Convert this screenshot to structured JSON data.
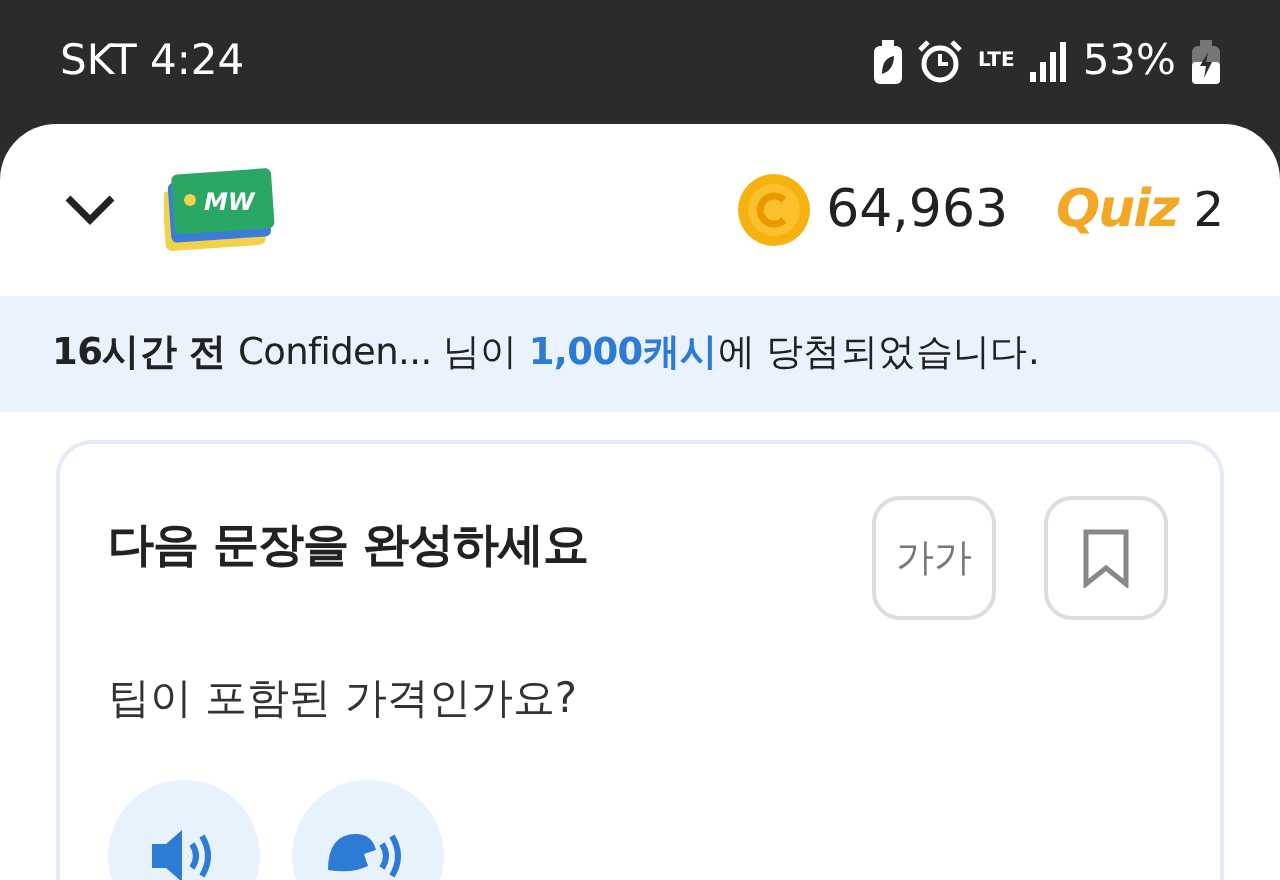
{
  "status_bar": {
    "carrier_time": "SKT 4:24",
    "network": "LTE",
    "battery": "53%"
  },
  "header": {
    "logo_text": "MW",
    "coins": "64,963",
    "quiz_logo": "Quiz",
    "quiz_count": "2"
  },
  "notice": [
    {
      "kind": "strong",
      "text": "16시간 전"
    },
    {
      "kind": "plain",
      "text": " Confiden... 님이 "
    },
    {
      "kind": "highlight",
      "text": "1,000캐시"
    },
    {
      "kind": "plain",
      "text": "에 당첨되었습니다."
    }
  ],
  "card": {
    "title": "다음 문장을 완성하세요",
    "font_button": "가가",
    "bookmarked": false,
    "question": "팁이 포함된 가격인가요?"
  }
}
